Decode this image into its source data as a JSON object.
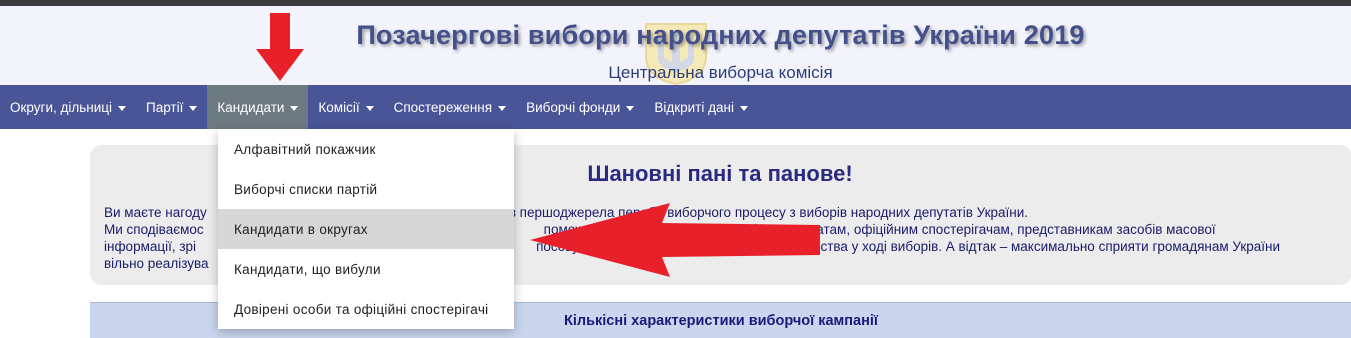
{
  "header": {
    "title": "Позачергові вибори народних депутатів України 2019",
    "subtitle": "Центральна виборча комісія"
  },
  "nav": {
    "items": [
      {
        "label": "Округи, дільниці"
      },
      {
        "label": "Партії"
      },
      {
        "label": "Кандидати"
      },
      {
        "label": "Комісії"
      },
      {
        "label": "Спостереження"
      },
      {
        "label": "Виборчі фонди"
      },
      {
        "label": "Відкриті дані"
      }
    ],
    "active_index": 2
  },
  "dropdown": {
    "items": [
      {
        "label": "Алфавітний покажчик"
      },
      {
        "label": "Виборчі списки партій"
      },
      {
        "label": "Кандидати в округах"
      },
      {
        "label": "Кандидати, що вибули"
      },
      {
        "label": "Довірені особи та офіційні спостерігачі"
      }
    ],
    "highlighted_index": 2
  },
  "greeting": {
    "title": "Шановні пані та панове!",
    "paragraphs": [
      "Ви маєте нагоду з першоджерела перебіг виборчого процесу з виборів народних депутатів України.",
      "Ми сподіваємось, що допоможе виборцям, кандидатам, офіційним спостерігачам, представникам засобів масової інформації, зро... посовува... вства у ході виборів. А відтак – максимально сприяти громадянам України вільно реалізува..."
    ],
    "line1_left": "Ви маєте нагоду",
    "line1_right": "з першоджерела перебіг виборчого процесу з виборів народних депутатів України.",
    "line2_left": "Ми сподіваємос",
    "line2_mid": "поможе",
    "line2_right": "рів, кандидатам, офіційним спостерігачам, представникам засобів масової",
    "line3_left": "інформації, зрі",
    "line3_mid": "посовува",
    "line3_right": "вства у ході виборів. А відтак – максимально сприяти громадянам України",
    "line4_left": "вільно реалізува"
  },
  "stats": {
    "title": "Кількісні характеристики виборчої кампанії"
  },
  "colors": {
    "nav_bg": "#4a5598",
    "nav_active": "#6e7a82",
    "title_color": "#43508c",
    "annotation_red": "#e8202a"
  },
  "annotations": {
    "arrows": [
      "down-arrow-over-candidates-menu",
      "left-arrow-to-candidates-in-districts"
    ]
  }
}
